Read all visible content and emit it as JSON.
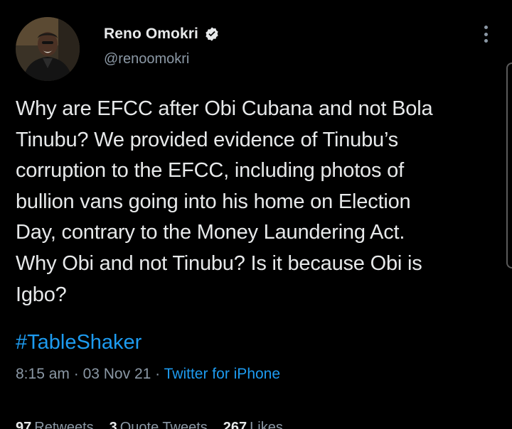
{
  "author": {
    "display_name": "Reno Omokri",
    "handle": "@renoomokri",
    "verified_icon": "verified-badge-icon"
  },
  "tweet": {
    "text": "Why are EFCC after Obi Cubana and not Bola\nTinubu? We provided evidence of Tinubu’s\ncorruption to the EFCC, including photos of\nbullion vans going into his home on Election\nDay, contrary to the Money Laundering Act.\nWhy Obi and not Tinubu? Is it because Obi is\nIgbo?",
    "hashtag": "#TableShaker",
    "time": "8:15 am",
    "date": "03 Nov 21",
    "separator": "·",
    "source": "Twitter for iPhone"
  },
  "stats": {
    "retweets_count": "97",
    "retweets_label": "Retweets",
    "quotes_count": "3",
    "quotes_label": "Quote Tweets",
    "likes_count": "267",
    "likes_label": "Likes"
  },
  "colors": {
    "background": "#000000",
    "text": "#e7e9ea",
    "secondary": "#8b98a5",
    "accent": "#1d9bf0"
  }
}
